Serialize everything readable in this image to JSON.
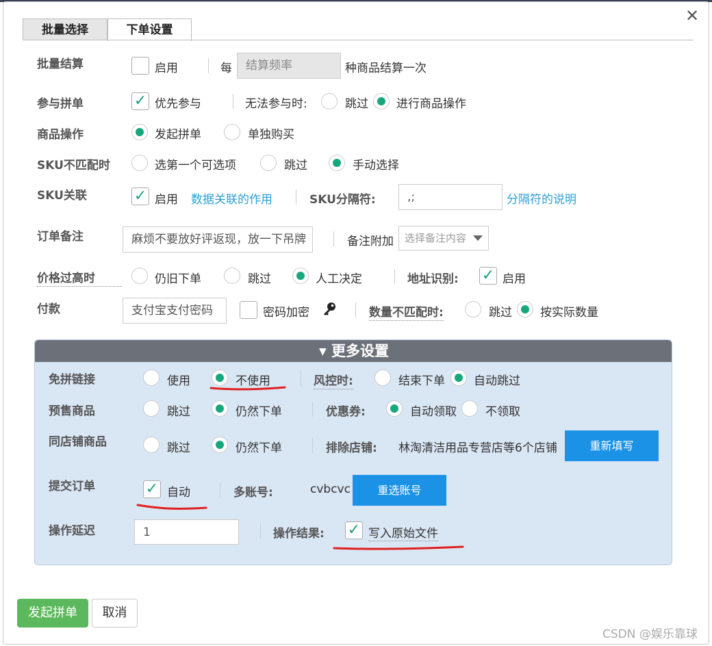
{
  "tabs": [
    {
      "label": "批量选择"
    },
    {
      "label": "下单设置"
    }
  ],
  "close_glyph": "✕",
  "batch_settle": {
    "label": "批量结算",
    "enable": "启用",
    "every": "每",
    "freq_placeholder": "结算频率",
    "suffix": "种商品结算一次"
  },
  "group_buy": {
    "label": "参与拼单",
    "priority": "优先参与",
    "when_fail": "无法参与时:",
    "skip": "跳过",
    "operate": "进行商品操作"
  },
  "product_op": {
    "label": "商品操作",
    "start_group": "发起拼单",
    "buy_alone": "单独购买"
  },
  "sku_mismatch": {
    "label": "SKU不匹配时",
    "first": "选第一个可选项",
    "skip": "跳过",
    "manual": "手动选择"
  },
  "sku_link": {
    "label": "SKU关联",
    "enable": "启用",
    "link": "数据关联的作用",
    "sep_label": "SKU分隔符:",
    "sep_value": ",;",
    "sep_link": "分隔符的说明"
  },
  "order_note": {
    "label": "订单备注",
    "value": "麻烦不要放好评返现，放一下吊牌",
    "append_label": "备注附加",
    "append_placeholder": "选择备注内容"
  },
  "price_high": {
    "label": "价格过高时",
    "keep": "仍旧下单",
    "skip": "跳过",
    "manual": "人工决定",
    "addr_label": "地址识别:",
    "addr_enable": "启用"
  },
  "payment": {
    "label": "付款",
    "pwd_placeholder": "支付宝支付密码",
    "encrypt": "密码加密",
    "qty_label": "数量不匹配时:",
    "skip": "跳过",
    "actual": "按实际数量"
  },
  "more": {
    "title": "更多设置",
    "free_link": {
      "label": "免拼链接",
      "use": "使用",
      "not_use": "不使用"
    },
    "risk": {
      "label": "风控时:",
      "end": "结束下单",
      "auto_skip": "自动跳过"
    },
    "presale": {
      "label": "预售商品",
      "skip": "跳过",
      "still": "仍然下单"
    },
    "coupon": {
      "label": "优惠券:",
      "auto": "自动领取",
      "no": "不领取"
    },
    "same_shop": {
      "label": "同店铺商品",
      "skip": "跳过",
      "still": "仍然下单"
    },
    "exclude": {
      "label": "排除店铺:",
      "value": "林淘清洁用品专营店等6个店铺",
      "button": "重新填写"
    },
    "submit": {
      "label": "提交订单",
      "auto": "自动"
    },
    "multi": {
      "label": "多账号:",
      "value": "cvbcvc",
      "button": "重选账号"
    },
    "delay": {
      "label": "操作延迟",
      "value": "1"
    },
    "result": {
      "label": "操作结果:",
      "write": "写入原始文件"
    }
  },
  "footer": {
    "start": "发起拼单",
    "cancel": "取消"
  },
  "watermark": "CSDN @娱乐靠球",
  "colors": {
    "accent_green": "#17a77d",
    "blue_button": "#1c92e6",
    "green_button": "#5cb85c",
    "annotation_red": "#e02020"
  }
}
